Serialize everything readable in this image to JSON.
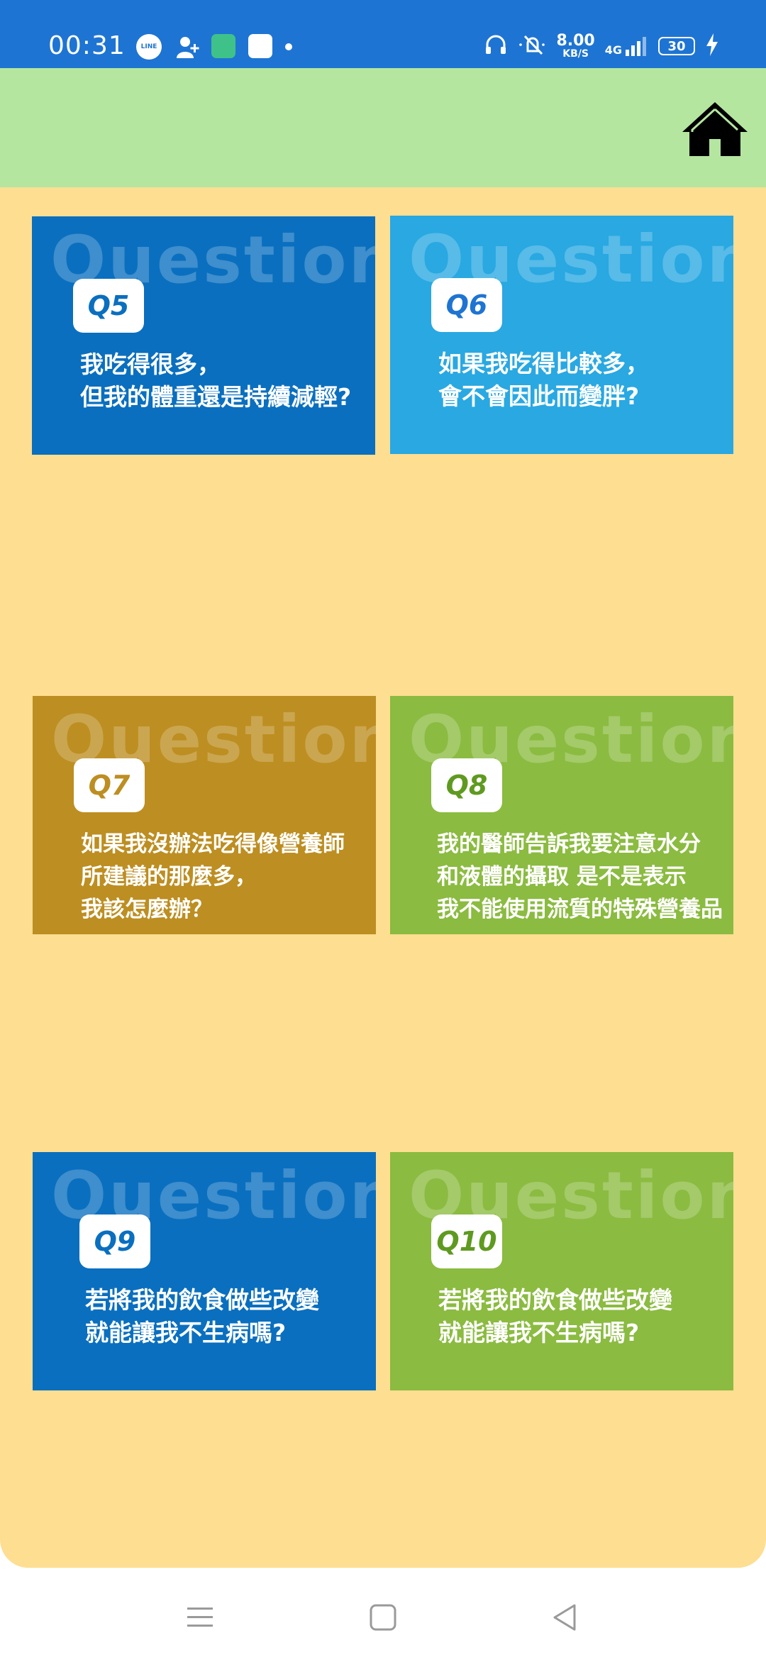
{
  "status_bar": {
    "time": "00:31",
    "line_label": "LINE",
    "speed_value": "8.00",
    "speed_unit": "KB/S",
    "network": "4G",
    "battery": "30",
    "icons": [
      "line-icon",
      "add-contact-icon",
      "app-icon",
      "notification-icon",
      "headset-icon",
      "mute-icon",
      "signal-icon",
      "battery-icon",
      "charging-icon"
    ]
  },
  "header": {
    "home_icon": "home-icon"
  },
  "colors": {
    "status_bar": "#1e74d2",
    "header_band": "#b4e6a0",
    "content_bg": "#fede91",
    "dark_blue": "#0a6fbf",
    "light_blue": "#29a8e2",
    "gold": "#bd8e21",
    "green": "#8bbb40"
  },
  "cards": [
    {
      "badge": "Q5",
      "watermark": "Question",
      "text": "我吃得很多，\n但我的體重還是持續減輕?",
      "color": "#0a6fbf"
    },
    {
      "badge": "Q6",
      "watermark": "Question",
      "text": "如果我吃得比較多，\n會不會因此而變胖?",
      "color": "#29a8e2"
    },
    {
      "badge": "Q7",
      "watermark": "Question",
      "text": "如果我沒辦法吃得像營養師\n所建議的那麼多，\n我該怎麼辦？",
      "color": "#bd8e21"
    },
    {
      "badge": "Q8",
      "watermark": "Question",
      "text": "我的醫師告訴我要注意水分\n和液體的攝取 是不是表示\n我不能使用流質的特殊營養品",
      "color": "#8bbb40"
    },
    {
      "badge": "Q9",
      "watermark": "Question",
      "text": "若將我的飲食做些改變\n就能讓我不生病嗎?",
      "color": "#0a6fbf"
    },
    {
      "badge": "Q10",
      "watermark": "Question",
      "text": "若將我的飲食做些改變\n就能讓我不生病嗎?",
      "color": "#8bbb40"
    }
  ],
  "nav_bar": {
    "items": [
      "menu-icon",
      "home-square-icon",
      "back-icon"
    ]
  }
}
